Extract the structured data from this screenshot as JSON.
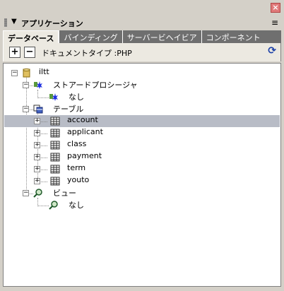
{
  "window": {
    "close_glyph": "×"
  },
  "panel": {
    "title": "アプリケーション",
    "collapse_glyph": "▼",
    "menu_glyph": "≡"
  },
  "tabs": [
    {
      "label": "データベース",
      "active": true
    },
    {
      "label": "バインディング",
      "active": false
    },
    {
      "label": "サーバービヘイビア",
      "active": false
    },
    {
      "label": "コンポーネント",
      "active": false
    }
  ],
  "toolbar": {
    "add_glyph": "+",
    "remove_glyph": "−",
    "doc_type": "ドキュメントタイプ :PHP",
    "refresh_glyph": "⟳"
  },
  "tree": {
    "root": {
      "label": "iltt",
      "icon": "database-icon"
    },
    "stored_procedures": {
      "label": "ストアードプロシージャ",
      "icon": "stored-procedure-icon",
      "child": "なし"
    },
    "tables": {
      "label": "テーブル",
      "icon": "table-group-icon",
      "items": [
        "account",
        "applicant",
        "class",
        "payment",
        "term",
        "youto"
      ],
      "selected": "account"
    },
    "views": {
      "label": "ビュー",
      "icon": "view-icon",
      "child": "なし"
    }
  },
  "colors": {
    "selection": "#b8bcc6",
    "tab_strip": "#6f6f6f",
    "panel": "#d4d0c8"
  }
}
